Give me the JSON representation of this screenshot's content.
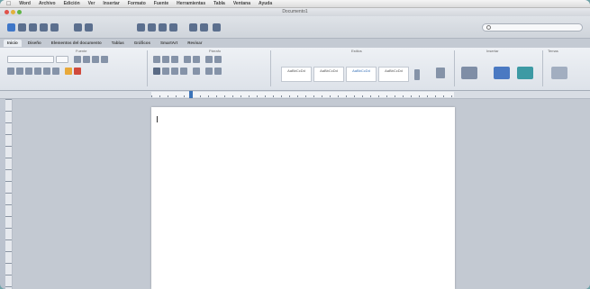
{
  "menubar": {
    "apple_icon": "apple-icon",
    "items": [
      "Word",
      "Archivo",
      "Edición",
      "Ver",
      "Insertar",
      "Formato",
      "Fuente",
      "Herramientas",
      "Tabla",
      "Ventana",
      "Ayuda"
    ]
  },
  "window": {
    "title": "Documento1"
  },
  "ribbon": {
    "tabs": [
      "Inicio",
      "Diseño",
      "Elementos del documento",
      "Tablas",
      "Gráficos",
      "SmartArt",
      "Revisar"
    ],
    "active_tab": "Inicio",
    "groups": [
      "Fuente",
      "Párrafo",
      "Estilos",
      "Insertar",
      "Temas"
    ],
    "font_name": "",
    "font_size": "",
    "styles": [
      "AaBbCcDd",
      "AaBbCcDd",
      "AaBbCcDd",
      "AaBbCcDd"
    ]
  },
  "colors": {
    "accent": "#3b73b9",
    "page": "#ffffff",
    "canvas": "#c3c9d2"
  }
}
